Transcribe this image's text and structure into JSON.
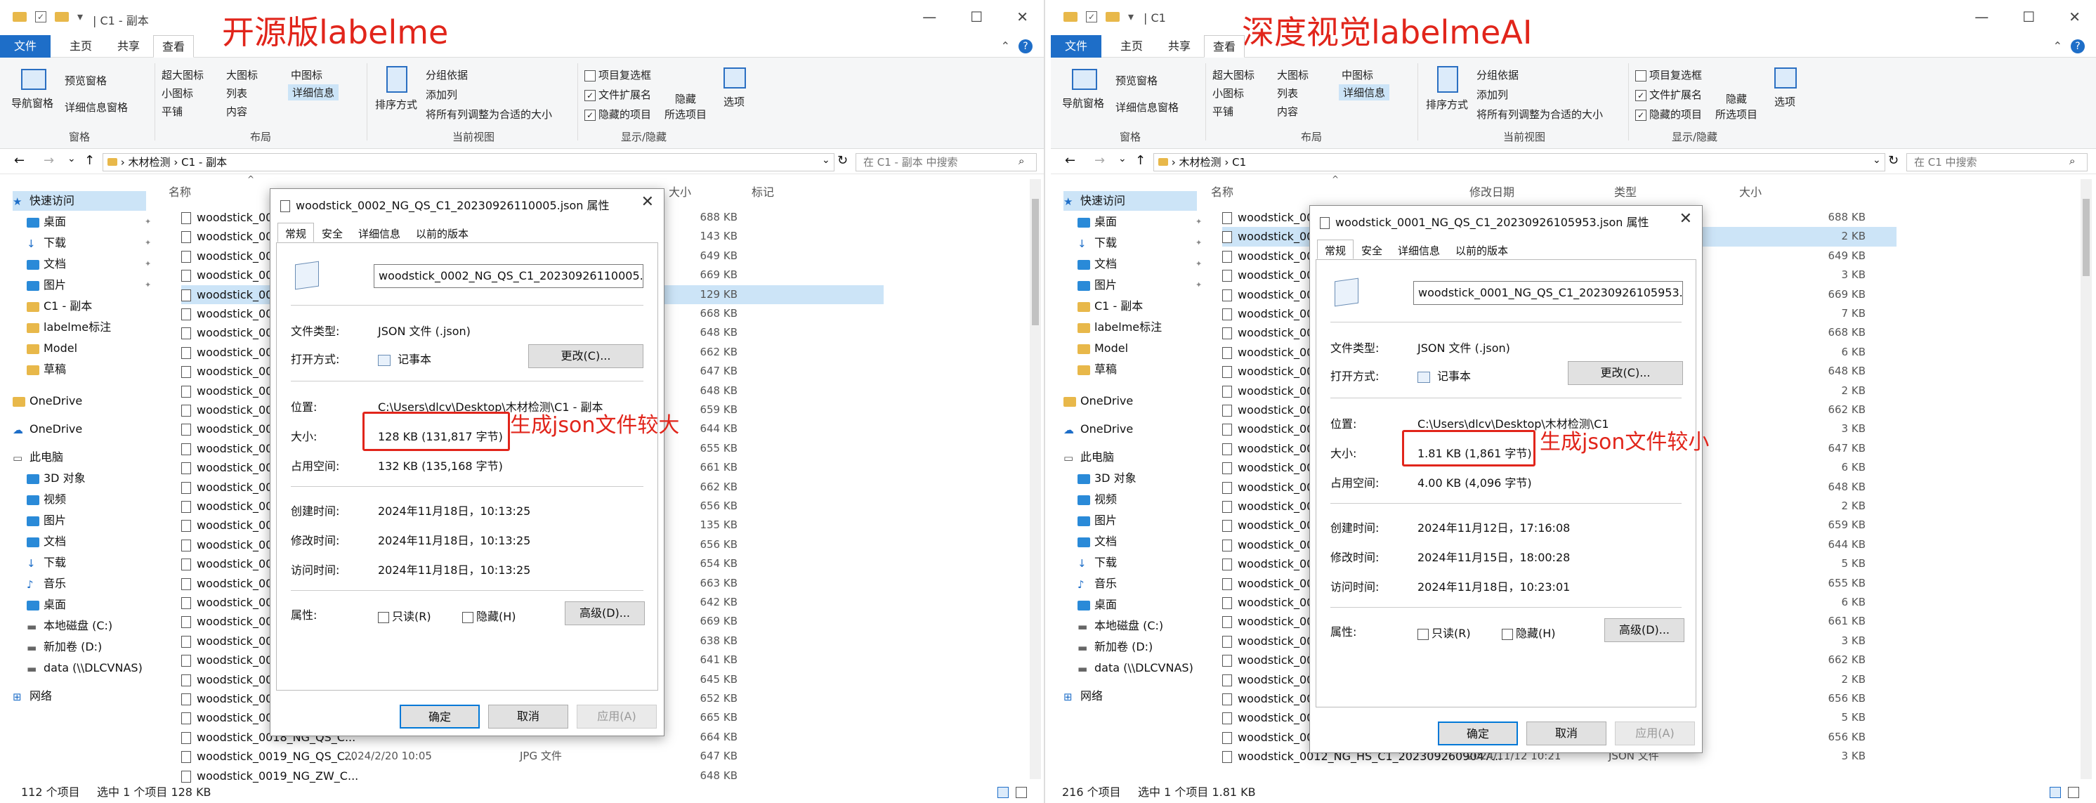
{
  "left": {
    "annotation": "开源版labelme",
    "window_title": "C1 - 副本",
    "ribbon_tabs": [
      "文件",
      "主页",
      "共享",
      "查看"
    ],
    "ribbon": {
      "nav_pane": "导航窗格",
      "preview_pane": "预览窗格",
      "details_pane": "详细信息窗格",
      "group_pane": "窗格",
      "xl_icons": "超大图标",
      "l_icons": "大图标",
      "m_icons": "中图标",
      "s_icons": "小图标",
      "list": "列表",
      "details": "详细信息",
      "tiles": "平铺",
      "content": "内容",
      "group_layout": "布局",
      "sort_by": "排序方式",
      "group_by": "分组依据",
      "add_col": "添加列",
      "fit_cols": "将所有列调整为合适的大小",
      "group_view": "当前视图",
      "item_check": "项目复选框",
      "ext": "文件扩展名",
      "hidden_items": "隐藏的项目",
      "hide_sel": "隐藏\n所选项目",
      "options": "选项",
      "group_showhide": "显示/隐藏"
    },
    "path": [
      "木材检测",
      "C1 - 副本"
    ],
    "search_placeholder": "在 C1 - 副本 中搜索",
    "nav": [
      "快速访问",
      "桌面",
      "下载",
      "文档",
      "图片",
      "C1 - 副本",
      "labelme标注",
      "Model",
      "草稿",
      "OneDrive",
      "OneDrive",
      "此电脑",
      "3D 对象",
      "视频",
      "图片",
      "文档",
      "下载",
      "音乐",
      "桌面",
      "本地磁盘 (C:)",
      "新加卷 (D:)",
      "data (\\\\DLCVNAS)",
      "网络"
    ],
    "col_name": "名称",
    "col_size": "大小",
    "col_tag": "标记",
    "files": [
      "woodstick_0001",
      "woodstick_0001",
      "woodstick_0001",
      "woodstick_0002",
      "woodstick_0002",
      "woodstick_0003",
      "woodstick_0004",
      "woodstick_0004",
      "woodstick_0005",
      "woodstick_0006",
      "woodstick_0006",
      "woodstick_0007",
      "woodstick_0008",
      "woodstick_0008",
      "woodstick_0010",
      "woodstick_0011",
      "woodstick_0011",
      "woodstick_0012",
      "woodstick_0012",
      "woodstick_0013",
      "woodstick_0013",
      "woodstick_0014",
      "woodstick_0014",
      "woodstick_0015",
      "woodstick_0016",
      "woodstick_0017",
      "woodstick_0018",
      "woodstick_0018_NG_QS_C...",
      "woodstick_0019_NG_QS_C...",
      "woodstick_0019_NG_ZW_C..."
    ],
    "sizes": [
      "688 KB",
      "143 KB",
      "649 KB",
      "669 KB",
      "129 KB",
      "668 KB",
      "648 KB",
      "662 KB",
      "647 KB",
      "648 KB",
      "659 KB",
      "644 KB",
      "655 KB",
      "661 KB",
      "662 KB",
      "656 KB",
      "135 KB",
      "656 KB",
      "654 KB",
      "663 KB",
      "642 KB",
      "669 KB",
      "638 KB",
      "641 KB",
      "645 KB",
      "652 KB",
      "665 KB",
      "664 KB",
      "647 KB",
      "648 KB"
    ],
    "extra_row_28": "2024/2/20 10:05",
    "extra_row_28_type": "JPG 文件",
    "status_count": "112 个项目",
    "status_sel": "选中 1 个项目  128 KB",
    "dialog": {
      "title": "woodstick_0002_NG_QS_C1_20230926110005.json 属性",
      "tabs": [
        "常规",
        "安全",
        "详细信息",
        "以前的版本"
      ],
      "filename": "woodstick_0002_NG_QS_C1_20230926110005.json",
      "type_label": "文件类型:",
      "type_value": "JSON 文件 (.json)",
      "open_label": "打开方式:",
      "open_value": "记事本",
      "change_btn": "更改(C)...",
      "loc_label": "位置:",
      "loc_value": "C:\\Users\\dlcv\\Desktop\\木材检测\\C1 - 副本",
      "size_label": "大小:",
      "size_value": "128 KB (131,817 字节)",
      "disk_label": "占用空间:",
      "disk_value": "132 KB (135,168 字节)",
      "created_label": "创建时间:",
      "created_value": "2024年11月18日，10:13:25",
      "modified_label": "修改时间:",
      "modified_value": "2024年11月18日，10:13:25",
      "accessed_label": "访问时间:",
      "accessed_value": "2024年11月18日，10:13:25",
      "attr_label": "属性:",
      "readonly": "只读(R)",
      "hidden": "隐藏(H)",
      "advanced": "高级(D)...",
      "ok": "确定",
      "cancel": "取消",
      "apply": "应用(A)"
    },
    "size_note": "生成json文件较大"
  },
  "right": {
    "annotation": "深度视觉labelmeAI",
    "window_title": "C1",
    "path": [
      "木材检测",
      "C1"
    ],
    "search_placeholder": "在 C1 中搜索",
    "nav": [
      "快速访问",
      "桌面",
      "下载",
      "文档",
      "图片",
      "C1 - 副本",
      "labelme标注",
      "Model",
      "草稿",
      "OneDrive",
      "OneDrive",
      "此电脑",
      "3D 对象",
      "视频",
      "图片",
      "文档",
      "下载",
      "音乐",
      "桌面",
      "本地磁盘 (C:)",
      "新加卷 (D:)",
      "data (\\\\DLCVNAS)",
      "网络"
    ],
    "col_name": "名称",
    "col_date": "修改日期",
    "col_type": "类型",
    "col_size": "大小",
    "files": [
      "woodstick_0001",
      "woodstick_0001",
      "woodstick_0001",
      "woodstick_0001",
      "woodstick_0002",
      "woodstick_0002",
      "woodstick_0003",
      "woodstick_0003",
      "woodstick_0004",
      "woodstick_0004",
      "woodstick_0004",
      "woodstick_0005",
      "woodstick_0005",
      "woodstick_0006",
      "woodstick_0006",
      "woodstick_0006",
      "woodstick_0006",
      "woodstick_0007",
      "woodstick_0007",
      "woodstick_0008",
      "woodstick_0008",
      "woodstick_0008",
      "woodstick_0008",
      "woodstick_0010",
      "woodstick_0010",
      "woodstick_0011",
      "woodstick_0011",
      "woodstick_0012_NG_QS_C1_20230926094...",
      "woodstick_0012_NG_HS_C1_2023092609047..."
    ],
    "sizes": [
      "688 KB",
      "2 KB",
      "649 KB",
      "3 KB",
      "669 KB",
      "7 KB",
      "668 KB",
      "6 KB",
      "648 KB",
      "2 KB",
      "662 KB",
      "3 KB",
      "647 KB",
      "6 KB",
      "648 KB",
      "2 KB",
      "659 KB",
      "644 KB",
      "5 KB",
      "655 KB",
      "6 KB",
      "661 KB",
      "3 KB",
      "662 KB",
      "2 KB",
      "656 KB",
      "5 KB",
      "656 KB",
      "3 KB"
    ],
    "last_date": "2024/11/12 10:21",
    "last_type": "JSON 文件",
    "status_count": "216 个项目",
    "status_sel": "选中 1 个项目  1.81 KB",
    "dialog": {
      "title": "woodstick_0001_NG_QS_C1_20230926105953.json 属性",
      "tabs": [
        "常规",
        "安全",
        "详细信息",
        "以前的版本"
      ],
      "filename": "woodstick_0001_NG_QS_C1_20230926105953.json",
      "type_label": "文件类型:",
      "type_value": "JSON 文件 (.json)",
      "open_label": "打开方式:",
      "open_value": "记事本",
      "change_btn": "更改(C)...",
      "loc_label": "位置:",
      "loc_value": "C:\\Users\\dlcv\\Desktop\\木材检测\\C1",
      "size_label": "大小:",
      "size_value": "1.81 KB (1,861 字节)",
      "disk_label": "占用空间:",
      "disk_value": "4.00 KB (4,096 字节)",
      "created_label": "创建时间:",
      "created_value": "2024年11月12日，17:16:08",
      "modified_label": "修改时间:",
      "modified_value": "2024年11月15日，18:00:28",
      "accessed_label": "访问时间:",
      "accessed_value": "2024年11月18日，10:23:01",
      "attr_label": "属性:",
      "readonly": "只读(R)",
      "hidden": "隐藏(H)",
      "advanced": "高级(D)...",
      "ok": "确定",
      "cancel": "取消",
      "apply": "应用(A)"
    },
    "size_note": "生成json文件较小"
  },
  "colors": {
    "accent": "#1e6ec8",
    "annotation": "#e1251b",
    "selected_row": "#cce4f7"
  }
}
